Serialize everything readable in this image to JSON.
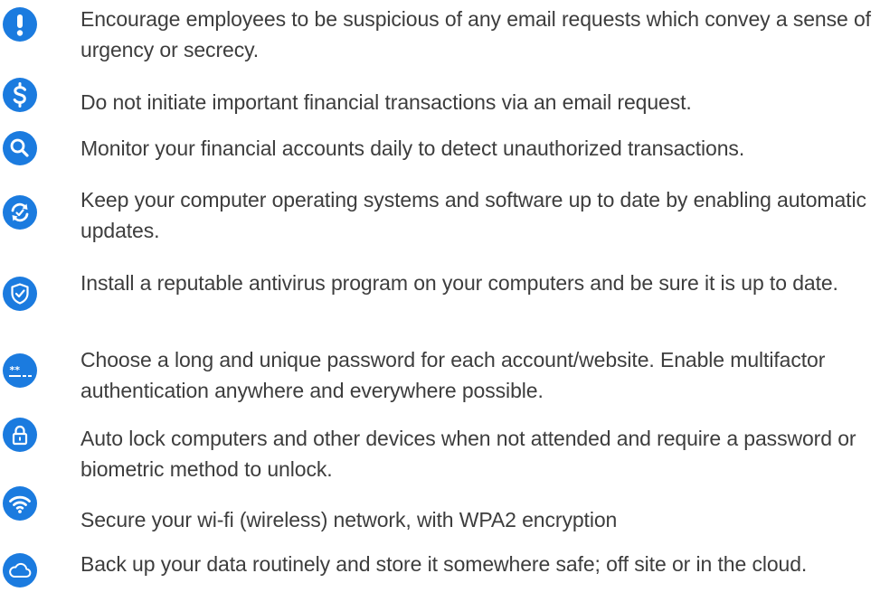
{
  "theme": {
    "icon_color": "#1b7bdf",
    "text_color": "#3d3d3d"
  },
  "tips": [
    {
      "icon": "exclamation-icon",
      "text": "Encourage employees to be suspicious of any email requests which convey a sense of urgency or secrecy."
    },
    {
      "icon": "dollar-icon",
      "text": "Do not initiate important financial transactions via an email request."
    },
    {
      "icon": "search-icon",
      "text": "Monitor your financial accounts daily to detect unauthorized transactions."
    },
    {
      "icon": "update-icon",
      "text": "Keep your computer operating systems and software up to date by enabling automatic updates."
    },
    {
      "icon": "shield-check-icon",
      "text": "Install a reputable antivirus program on your computers and be sure it is up to date."
    },
    {
      "icon": "password-icon",
      "text": "Choose a long and unique password for each account/website. Enable multifactor authentication anywhere and everywhere possible."
    },
    {
      "icon": "lock-icon",
      "text": "Auto lock computers and other devices when not attended and require a password or biometric method to unlock."
    },
    {
      "icon": "wifi-icon",
      "text": "Secure your wi-fi (wireless) network, with WPA2 encryption"
    },
    {
      "icon": "cloud-icon",
      "text": "Back up your data routinely and store it somewhere safe; off site or in the cloud."
    }
  ]
}
